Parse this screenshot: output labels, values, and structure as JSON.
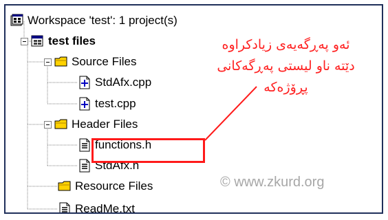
{
  "workspace": {
    "title": "Workspace 'test': 1 project(s)",
    "project": {
      "label": "test files",
      "folders": {
        "source": {
          "label": "Source Files",
          "files": [
            "StdAfx.cpp",
            "test.cpp"
          ]
        },
        "header": {
          "label": "Header Files",
          "files": [
            "functions.h",
            "StdAfx.h"
          ]
        },
        "resource": {
          "label": "Resource Files"
        }
      },
      "readme": "ReadMe.txt"
    }
  },
  "annotation": {
    "lines": [
      "ئەو پەڕگەیەی زیادکراوە",
      "دێتە ناو لیستی پەڕگەکانی",
      "پڕۆژەکە"
    ],
    "color": "#ff2020"
  },
  "watermark": "© www.zkurd.org",
  "colors": {
    "highlight_border": "#ff1a1a",
    "folder": "#ffd200",
    "frame": "#1f2f5a"
  },
  "icons": {
    "workspace": "workspace-icon",
    "project": "project-icon",
    "folder": "folder-icon",
    "cpp_file": "cpp-file-icon",
    "header_file": "header-file-icon",
    "text_file": "text-file-icon"
  }
}
